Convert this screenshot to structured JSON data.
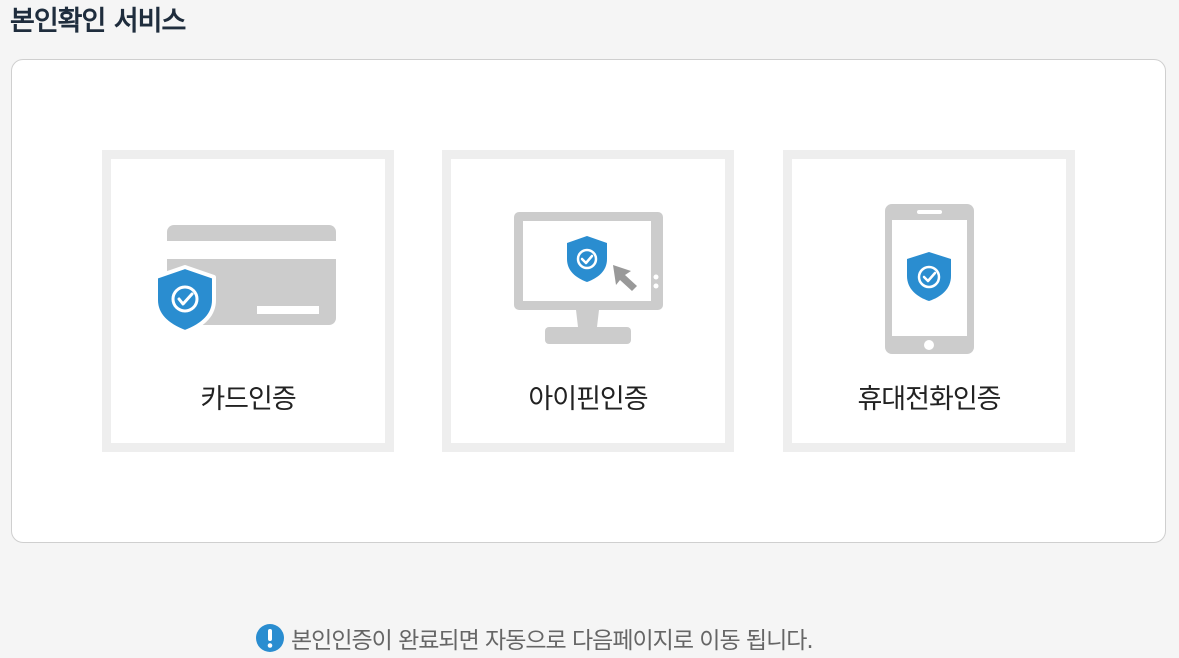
{
  "page": {
    "title": "본인확인 서비스"
  },
  "options": [
    {
      "id": "card",
      "label": "카드인증",
      "icon": "credit-card-shield-icon"
    },
    {
      "id": "ipin",
      "label": "아이핀인증",
      "icon": "monitor-shield-cursor-icon"
    },
    {
      "id": "phone",
      "label": "휴대전화인증",
      "icon": "mobile-phone-shield-icon"
    }
  ],
  "notice": {
    "icon": "exclamation-icon",
    "text": "본인인증이 완료되면 자동으로 다음페이지로 이동 됩니다."
  },
  "colors": {
    "shield": "#2a8dd0",
    "device_gray": "#cccccc",
    "tile_border": "#eeeeee",
    "title": "#1f2d3d"
  }
}
